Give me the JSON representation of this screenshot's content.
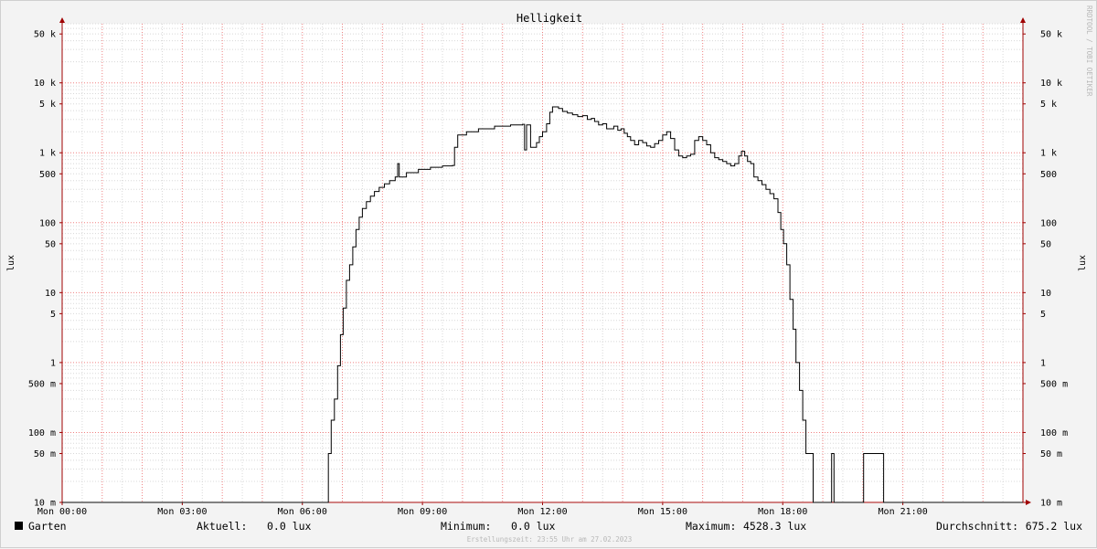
{
  "chart_data": {
    "type": "line",
    "title": "Helligkeit",
    "ylabel": "lux",
    "y_scale": "log",
    "ylim": [
      0.01,
      70000
    ],
    "x_unit": "hours",
    "xlim": [
      0,
      24
    ],
    "x_ticks": [
      {
        "value": 0,
        "label": "Mon 00:00"
      },
      {
        "value": 3,
        "label": "Mon 03:00"
      },
      {
        "value": 6,
        "label": "Mon 06:00"
      },
      {
        "value": 9,
        "label": "Mon 09:00"
      },
      {
        "value": 12,
        "label": "Mon 12:00"
      },
      {
        "value": 15,
        "label": "Mon 15:00"
      },
      {
        "value": 18,
        "label": "Mon 18:00"
      },
      {
        "value": 21,
        "label": "Mon 21:00"
      }
    ],
    "y_ticks": [
      {
        "value": 50000,
        "label": "50 k"
      },
      {
        "value": 10000,
        "label": "10 k"
      },
      {
        "value": 5000,
        "label": "5 k"
      },
      {
        "value": 1000,
        "label": "1 k"
      },
      {
        "value": 500,
        "label": "500"
      },
      {
        "value": 100,
        "label": "100"
      },
      {
        "value": 50,
        "label": "50"
      },
      {
        "value": 10,
        "label": "10"
      },
      {
        "value": 5,
        "label": "5"
      },
      {
        "value": 1,
        "label": "1"
      },
      {
        "value": 0.5,
        "label": "500 m"
      },
      {
        "value": 0.1,
        "label": "100 m"
      },
      {
        "value": 0.05,
        "label": "50 m"
      },
      {
        "value": 0.01,
        "label": "10 m"
      }
    ],
    "grid": true,
    "series": [
      {
        "name": "Garten",
        "color": "#000000",
        "points": [
          [
            0.0,
            0.01
          ],
          [
            6.6,
            0.01
          ],
          [
            6.65,
            0.05
          ],
          [
            6.72,
            0.15
          ],
          [
            6.8,
            0.3
          ],
          [
            6.88,
            0.9
          ],
          [
            6.95,
            2.5
          ],
          [
            7.02,
            6
          ],
          [
            7.1,
            15
          ],
          [
            7.18,
            25
          ],
          [
            7.26,
            45
          ],
          [
            7.34,
            80
          ],
          [
            7.42,
            120
          ],
          [
            7.5,
            160
          ],
          [
            7.6,
            200
          ],
          [
            7.7,
            240
          ],
          [
            7.8,
            280
          ],
          [
            7.92,
            320
          ],
          [
            8.05,
            360
          ],
          [
            8.18,
            400
          ],
          [
            8.32,
            450
          ],
          [
            8.38,
            700
          ],
          [
            8.42,
            450
          ],
          [
            8.6,
            520
          ],
          [
            8.9,
            580
          ],
          [
            9.2,
            620
          ],
          [
            9.5,
            650
          ],
          [
            9.75,
            660
          ],
          [
            9.8,
            1200
          ],
          [
            9.88,
            1800
          ],
          [
            10.1,
            2000
          ],
          [
            10.4,
            2200
          ],
          [
            10.8,
            2400
          ],
          [
            11.2,
            2500
          ],
          [
            11.5,
            2550
          ],
          [
            11.55,
            1100
          ],
          [
            11.6,
            2500
          ],
          [
            11.7,
            1200
          ],
          [
            11.78,
            1200
          ],
          [
            11.85,
            1400
          ],
          [
            11.92,
            1700
          ],
          [
            12.0,
            2000
          ],
          [
            12.1,
            2600
          ],
          [
            12.18,
            3800
          ],
          [
            12.25,
            4528.3
          ],
          [
            12.4,
            4300
          ],
          [
            12.5,
            3900
          ],
          [
            12.62,
            3700
          ],
          [
            12.75,
            3500
          ],
          [
            12.88,
            3300
          ],
          [
            13.0,
            3400
          ],
          [
            13.12,
            3000
          ],
          [
            13.22,
            3100
          ],
          [
            13.3,
            2800
          ],
          [
            13.4,
            2500
          ],
          [
            13.5,
            2600
          ],
          [
            13.6,
            2200
          ],
          [
            13.7,
            2200
          ],
          [
            13.78,
            2400
          ],
          [
            13.88,
            2100
          ],
          [
            13.96,
            2200
          ],
          [
            14.04,
            1900
          ],
          [
            14.12,
            1700
          ],
          [
            14.2,
            1500
          ],
          [
            14.3,
            1300
          ],
          [
            14.4,
            1500
          ],
          [
            14.5,
            1400
          ],
          [
            14.6,
            1250
          ],
          [
            14.7,
            1200
          ],
          [
            14.8,
            1350
          ],
          [
            14.9,
            1500
          ],
          [
            15.0,
            1800
          ],
          [
            15.1,
            2000
          ],
          [
            15.2,
            1600
          ],
          [
            15.3,
            1100
          ],
          [
            15.4,
            900
          ],
          [
            15.5,
            850
          ],
          [
            15.6,
            900
          ],
          [
            15.7,
            950
          ],
          [
            15.8,
            1500
          ],
          [
            15.9,
            1700
          ],
          [
            16.0,
            1500
          ],
          [
            16.1,
            1300
          ],
          [
            16.2,
            1000
          ],
          [
            16.3,
            850
          ],
          [
            16.4,
            800
          ],
          [
            16.5,
            750
          ],
          [
            16.6,
            700
          ],
          [
            16.7,
            650
          ],
          [
            16.8,
            700
          ],
          [
            16.9,
            900
          ],
          [
            16.97,
            1050
          ],
          [
            17.05,
            900
          ],
          [
            17.12,
            750
          ],
          [
            17.2,
            700
          ],
          [
            17.28,
            450
          ],
          [
            17.38,
            400
          ],
          [
            17.48,
            350
          ],
          [
            17.58,
            300
          ],
          [
            17.68,
            260
          ],
          [
            17.78,
            220
          ],
          [
            17.88,
            140
          ],
          [
            17.95,
            80
          ],
          [
            18.02,
            50
          ],
          [
            18.1,
            25
          ],
          [
            18.18,
            8
          ],
          [
            18.26,
            3
          ],
          [
            18.33,
            1
          ],
          [
            18.42,
            0.4
          ],
          [
            18.5,
            0.15
          ],
          [
            18.58,
            0.05
          ],
          [
            18.7,
            0.05
          ],
          [
            18.76,
            0.01
          ],
          [
            19.2,
            0.01
          ],
          [
            19.22,
            0.05
          ],
          [
            19.28,
            0.01
          ],
          [
            20.0,
            0.01
          ],
          [
            20.02,
            0.05
          ],
          [
            20.5,
            0.05
          ],
          [
            20.52,
            0.01
          ],
          [
            24.0,
            0.01
          ]
        ]
      }
    ],
    "legend": {
      "position": "bottom",
      "name": "Garten",
      "current_label": "Aktuell:",
      "current_value": "0.0 lux",
      "min_label": "Minimum:",
      "min_value": "0.0 lux",
      "max_label": "Maximum:",
      "max_value": "4528.3 lux",
      "avg_label": "Durchschnitt:",
      "avg_value": "675.2 lux"
    },
    "footer": "Erstellungszeit: 23:55 Uhr am 27.02.2023",
    "watermark": "RRDTOOL / TOBI OETIKER"
  },
  "colors": {
    "background": "#f3f3f3",
    "plot_bg": "#ffffff",
    "major_grid": "#f08080",
    "minor_grid": "#d8d8d8",
    "axis": "#a00000",
    "line": "#000000"
  }
}
